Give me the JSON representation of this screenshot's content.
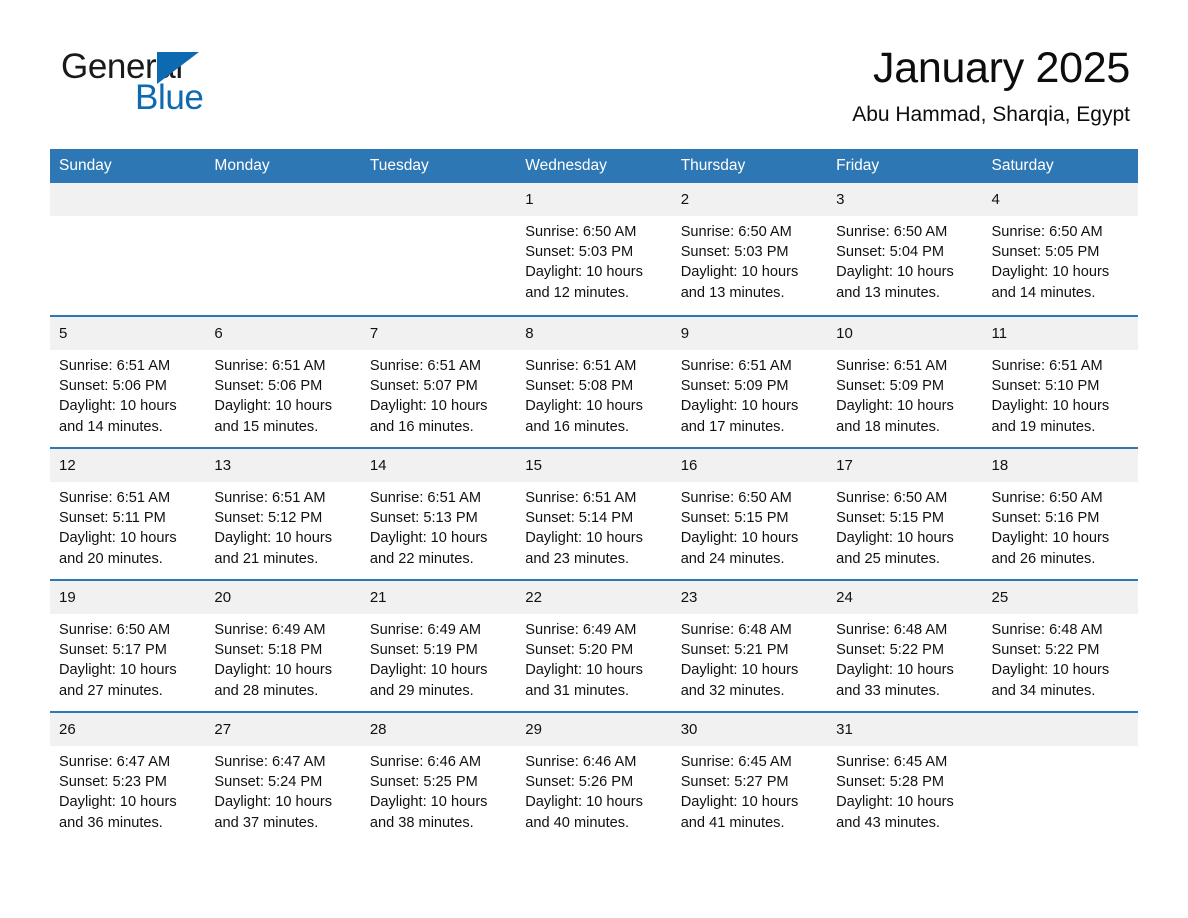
{
  "logo": {
    "word_one": "General",
    "word_two": "Blue",
    "triangle_color": "#0e6ab0"
  },
  "header": {
    "month_title": "January 2025",
    "location": "Abu Hammad, Sharqia, Egypt"
  },
  "theme": {
    "header_blue": "#2e77b5",
    "daynum_band": "#f1f1f1",
    "text": "#111111"
  },
  "weekday_headers": [
    "Sunday",
    "Monday",
    "Tuesday",
    "Wednesday",
    "Thursday",
    "Friday",
    "Saturday"
  ],
  "weeks": [
    [
      {
        "day": "",
        "info": ""
      },
      {
        "day": "",
        "info": ""
      },
      {
        "day": "",
        "info": ""
      },
      {
        "day": "1",
        "info": "Sunrise: 6:50 AM\nSunset: 5:03 PM\nDaylight: 10 hours\nand 12 minutes."
      },
      {
        "day": "2",
        "info": "Sunrise: 6:50 AM\nSunset: 5:03 PM\nDaylight: 10 hours\nand 13 minutes."
      },
      {
        "day": "3",
        "info": "Sunrise: 6:50 AM\nSunset: 5:04 PM\nDaylight: 10 hours\nand 13 minutes."
      },
      {
        "day": "4",
        "info": "Sunrise: 6:50 AM\nSunset: 5:05 PM\nDaylight: 10 hours\nand 14 minutes."
      }
    ],
    [
      {
        "day": "5",
        "info": "Sunrise: 6:51 AM\nSunset: 5:06 PM\nDaylight: 10 hours\nand 14 minutes."
      },
      {
        "day": "6",
        "info": "Sunrise: 6:51 AM\nSunset: 5:06 PM\nDaylight: 10 hours\nand 15 minutes."
      },
      {
        "day": "7",
        "info": "Sunrise: 6:51 AM\nSunset: 5:07 PM\nDaylight: 10 hours\nand 16 minutes."
      },
      {
        "day": "8",
        "info": "Sunrise: 6:51 AM\nSunset: 5:08 PM\nDaylight: 10 hours\nand 16 minutes."
      },
      {
        "day": "9",
        "info": "Sunrise: 6:51 AM\nSunset: 5:09 PM\nDaylight: 10 hours\nand 17 minutes."
      },
      {
        "day": "10",
        "info": "Sunrise: 6:51 AM\nSunset: 5:09 PM\nDaylight: 10 hours\nand 18 minutes."
      },
      {
        "day": "11",
        "info": "Sunrise: 6:51 AM\nSunset: 5:10 PM\nDaylight: 10 hours\nand 19 minutes."
      }
    ],
    [
      {
        "day": "12",
        "info": "Sunrise: 6:51 AM\nSunset: 5:11 PM\nDaylight: 10 hours\nand 20 minutes."
      },
      {
        "day": "13",
        "info": "Sunrise: 6:51 AM\nSunset: 5:12 PM\nDaylight: 10 hours\nand 21 minutes."
      },
      {
        "day": "14",
        "info": "Sunrise: 6:51 AM\nSunset: 5:13 PM\nDaylight: 10 hours\nand 22 minutes."
      },
      {
        "day": "15",
        "info": "Sunrise: 6:51 AM\nSunset: 5:14 PM\nDaylight: 10 hours\nand 23 minutes."
      },
      {
        "day": "16",
        "info": "Sunrise: 6:50 AM\nSunset: 5:15 PM\nDaylight: 10 hours\nand 24 minutes."
      },
      {
        "day": "17",
        "info": "Sunrise: 6:50 AM\nSunset: 5:15 PM\nDaylight: 10 hours\nand 25 minutes."
      },
      {
        "day": "18",
        "info": "Sunrise: 6:50 AM\nSunset: 5:16 PM\nDaylight: 10 hours\nand 26 minutes."
      }
    ],
    [
      {
        "day": "19",
        "info": "Sunrise: 6:50 AM\nSunset: 5:17 PM\nDaylight: 10 hours\nand 27 minutes."
      },
      {
        "day": "20",
        "info": "Sunrise: 6:49 AM\nSunset: 5:18 PM\nDaylight: 10 hours\nand 28 minutes."
      },
      {
        "day": "21",
        "info": "Sunrise: 6:49 AM\nSunset: 5:19 PM\nDaylight: 10 hours\nand 29 minutes."
      },
      {
        "day": "22",
        "info": "Sunrise: 6:49 AM\nSunset: 5:20 PM\nDaylight: 10 hours\nand 31 minutes."
      },
      {
        "day": "23",
        "info": "Sunrise: 6:48 AM\nSunset: 5:21 PM\nDaylight: 10 hours\nand 32 minutes."
      },
      {
        "day": "24",
        "info": "Sunrise: 6:48 AM\nSunset: 5:22 PM\nDaylight: 10 hours\nand 33 minutes."
      },
      {
        "day": "25",
        "info": "Sunrise: 6:48 AM\nSunset: 5:22 PM\nDaylight: 10 hours\nand 34 minutes."
      }
    ],
    [
      {
        "day": "26",
        "info": "Sunrise: 6:47 AM\nSunset: 5:23 PM\nDaylight: 10 hours\nand 36 minutes."
      },
      {
        "day": "27",
        "info": "Sunrise: 6:47 AM\nSunset: 5:24 PM\nDaylight: 10 hours\nand 37 minutes."
      },
      {
        "day": "28",
        "info": "Sunrise: 6:46 AM\nSunset: 5:25 PM\nDaylight: 10 hours\nand 38 minutes."
      },
      {
        "day": "29",
        "info": "Sunrise: 6:46 AM\nSunset: 5:26 PM\nDaylight: 10 hours\nand 40 minutes."
      },
      {
        "day": "30",
        "info": "Sunrise: 6:45 AM\nSunset: 5:27 PM\nDaylight: 10 hours\nand 41 minutes."
      },
      {
        "day": "31",
        "info": "Sunrise: 6:45 AM\nSunset: 5:28 PM\nDaylight: 10 hours\nand 43 minutes."
      },
      {
        "day": "",
        "info": ""
      }
    ]
  ]
}
